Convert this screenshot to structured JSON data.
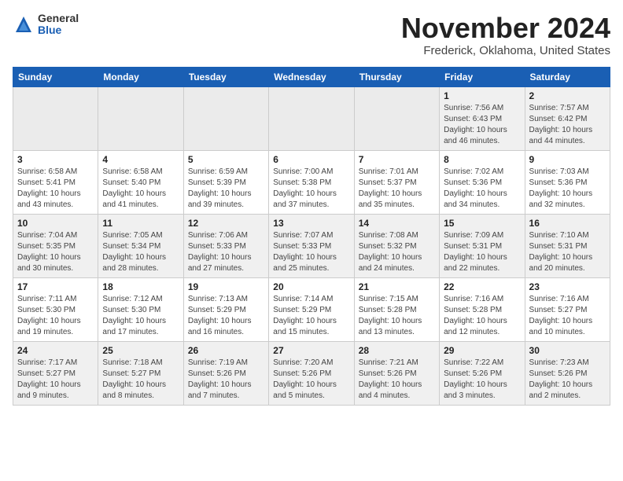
{
  "logo": {
    "general": "General",
    "blue": "Blue"
  },
  "title": "November 2024",
  "location": "Frederick, Oklahoma, United States",
  "weekdays": [
    "Sunday",
    "Monday",
    "Tuesday",
    "Wednesday",
    "Thursday",
    "Friday",
    "Saturday"
  ],
  "weeks": [
    [
      {
        "day": "",
        "info": ""
      },
      {
        "day": "",
        "info": ""
      },
      {
        "day": "",
        "info": ""
      },
      {
        "day": "",
        "info": ""
      },
      {
        "day": "",
        "info": ""
      },
      {
        "day": "1",
        "info": "Sunrise: 7:56 AM\nSunset: 6:43 PM\nDaylight: 10 hours\nand 46 minutes."
      },
      {
        "day": "2",
        "info": "Sunrise: 7:57 AM\nSunset: 6:42 PM\nDaylight: 10 hours\nand 44 minutes."
      }
    ],
    [
      {
        "day": "3",
        "info": "Sunrise: 6:58 AM\nSunset: 5:41 PM\nDaylight: 10 hours\nand 43 minutes."
      },
      {
        "day": "4",
        "info": "Sunrise: 6:58 AM\nSunset: 5:40 PM\nDaylight: 10 hours\nand 41 minutes."
      },
      {
        "day": "5",
        "info": "Sunrise: 6:59 AM\nSunset: 5:39 PM\nDaylight: 10 hours\nand 39 minutes."
      },
      {
        "day": "6",
        "info": "Sunrise: 7:00 AM\nSunset: 5:38 PM\nDaylight: 10 hours\nand 37 minutes."
      },
      {
        "day": "7",
        "info": "Sunrise: 7:01 AM\nSunset: 5:37 PM\nDaylight: 10 hours\nand 35 minutes."
      },
      {
        "day": "8",
        "info": "Sunrise: 7:02 AM\nSunset: 5:36 PM\nDaylight: 10 hours\nand 34 minutes."
      },
      {
        "day": "9",
        "info": "Sunrise: 7:03 AM\nSunset: 5:36 PM\nDaylight: 10 hours\nand 32 minutes."
      }
    ],
    [
      {
        "day": "10",
        "info": "Sunrise: 7:04 AM\nSunset: 5:35 PM\nDaylight: 10 hours\nand 30 minutes."
      },
      {
        "day": "11",
        "info": "Sunrise: 7:05 AM\nSunset: 5:34 PM\nDaylight: 10 hours\nand 28 minutes."
      },
      {
        "day": "12",
        "info": "Sunrise: 7:06 AM\nSunset: 5:33 PM\nDaylight: 10 hours\nand 27 minutes."
      },
      {
        "day": "13",
        "info": "Sunrise: 7:07 AM\nSunset: 5:33 PM\nDaylight: 10 hours\nand 25 minutes."
      },
      {
        "day": "14",
        "info": "Sunrise: 7:08 AM\nSunset: 5:32 PM\nDaylight: 10 hours\nand 24 minutes."
      },
      {
        "day": "15",
        "info": "Sunrise: 7:09 AM\nSunset: 5:31 PM\nDaylight: 10 hours\nand 22 minutes."
      },
      {
        "day": "16",
        "info": "Sunrise: 7:10 AM\nSunset: 5:31 PM\nDaylight: 10 hours\nand 20 minutes."
      }
    ],
    [
      {
        "day": "17",
        "info": "Sunrise: 7:11 AM\nSunset: 5:30 PM\nDaylight: 10 hours\nand 19 minutes."
      },
      {
        "day": "18",
        "info": "Sunrise: 7:12 AM\nSunset: 5:30 PM\nDaylight: 10 hours\nand 17 minutes."
      },
      {
        "day": "19",
        "info": "Sunrise: 7:13 AM\nSunset: 5:29 PM\nDaylight: 10 hours\nand 16 minutes."
      },
      {
        "day": "20",
        "info": "Sunrise: 7:14 AM\nSunset: 5:29 PM\nDaylight: 10 hours\nand 15 minutes."
      },
      {
        "day": "21",
        "info": "Sunrise: 7:15 AM\nSunset: 5:28 PM\nDaylight: 10 hours\nand 13 minutes."
      },
      {
        "day": "22",
        "info": "Sunrise: 7:16 AM\nSunset: 5:28 PM\nDaylight: 10 hours\nand 12 minutes."
      },
      {
        "day": "23",
        "info": "Sunrise: 7:16 AM\nSunset: 5:27 PM\nDaylight: 10 hours\nand 10 minutes."
      }
    ],
    [
      {
        "day": "24",
        "info": "Sunrise: 7:17 AM\nSunset: 5:27 PM\nDaylight: 10 hours\nand 9 minutes."
      },
      {
        "day": "25",
        "info": "Sunrise: 7:18 AM\nSunset: 5:27 PM\nDaylight: 10 hours\nand 8 minutes."
      },
      {
        "day": "26",
        "info": "Sunrise: 7:19 AM\nSunset: 5:26 PM\nDaylight: 10 hours\nand 7 minutes."
      },
      {
        "day": "27",
        "info": "Sunrise: 7:20 AM\nSunset: 5:26 PM\nDaylight: 10 hours\nand 5 minutes."
      },
      {
        "day": "28",
        "info": "Sunrise: 7:21 AM\nSunset: 5:26 PM\nDaylight: 10 hours\nand 4 minutes."
      },
      {
        "day": "29",
        "info": "Sunrise: 7:22 AM\nSunset: 5:26 PM\nDaylight: 10 hours\nand 3 minutes."
      },
      {
        "day": "30",
        "info": "Sunrise: 7:23 AM\nSunset: 5:26 PM\nDaylight: 10 hours\nand 2 minutes."
      }
    ]
  ]
}
